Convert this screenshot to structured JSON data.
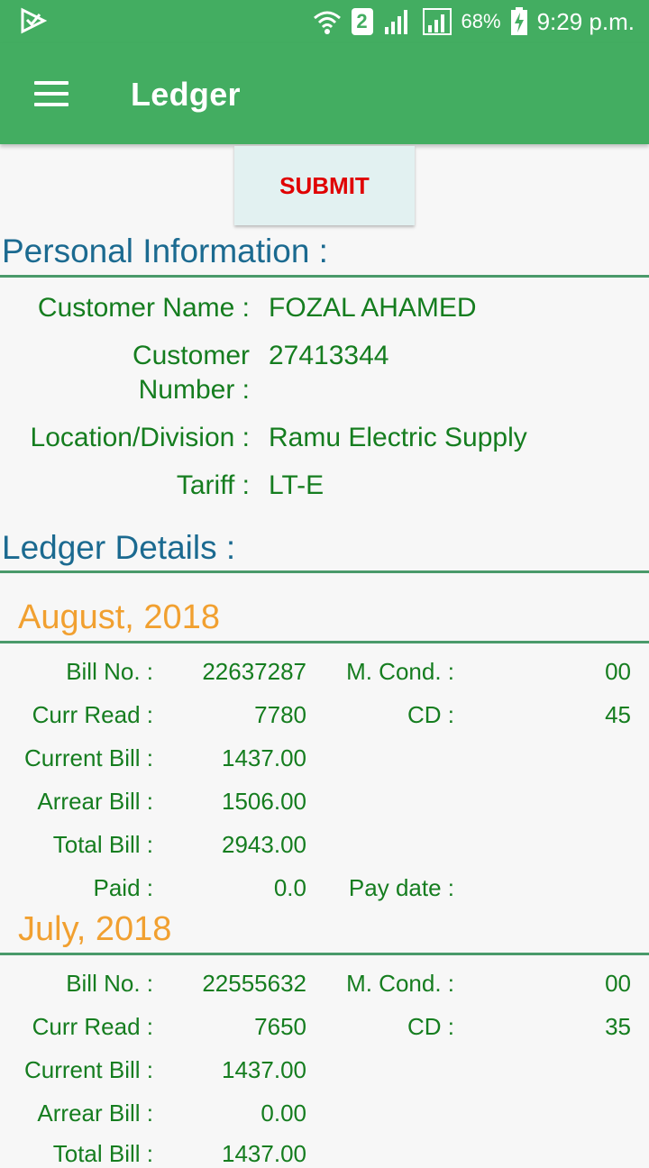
{
  "status_bar": {
    "sim_slot": "2",
    "battery": "68%",
    "time": "9:29 p.m."
  },
  "app_bar": {
    "title": "Ledger",
    "menu_icon": "hamburger-menu-icon"
  },
  "submit_label": "SUBMIT",
  "personal": {
    "heading": "Personal Information :",
    "name_label": "Customer Name :",
    "name_value": "FOZAL AHAMED",
    "number_label_line1": "Customer",
    "number_label_line2": "Number :",
    "number_value": "27413344",
    "location_label": "Location/Division :",
    "location_value": "Ramu Electric Supply",
    "tariff_label": "Tariff :",
    "tariff_value": "LT-E"
  },
  "ledger_heading": "Ledger Details :",
  "ledger": [
    {
      "month": "August, 2018",
      "bill_no_label": "Bill No. :",
      "bill_no": "22637287",
      "mcond_label": "M. Cond. :",
      "mcond": "00",
      "curr_read_label": "Curr Read :",
      "curr_read": "7780",
      "cd_label": "CD :",
      "cd": "45",
      "current_bill_label": "Current Bill :",
      "current_bill": "1437.00",
      "arrear_bill_label": "Arrear Bill :",
      "arrear_bill": "1506.00",
      "total_bill_label": "Total Bill :",
      "total_bill": "2943.00",
      "paid_label": "Paid :",
      "paid": "0.0",
      "pay_date_label": "Pay date :",
      "pay_date": ""
    },
    {
      "month": "July, 2018",
      "bill_no_label": "Bill No. :",
      "bill_no": "22555632",
      "mcond_label": "M. Cond. :",
      "mcond": "00",
      "curr_read_label": "Curr Read :",
      "curr_read": "7650",
      "cd_label": "CD :",
      "cd": "35",
      "current_bill_label": "Current Bill :",
      "current_bill": "1437.00",
      "arrear_bill_label": "Arrear Bill :",
      "arrear_bill": "0.00",
      "total_bill_label": "Total Bill :",
      "total_bill": "1437.00"
    }
  ]
}
